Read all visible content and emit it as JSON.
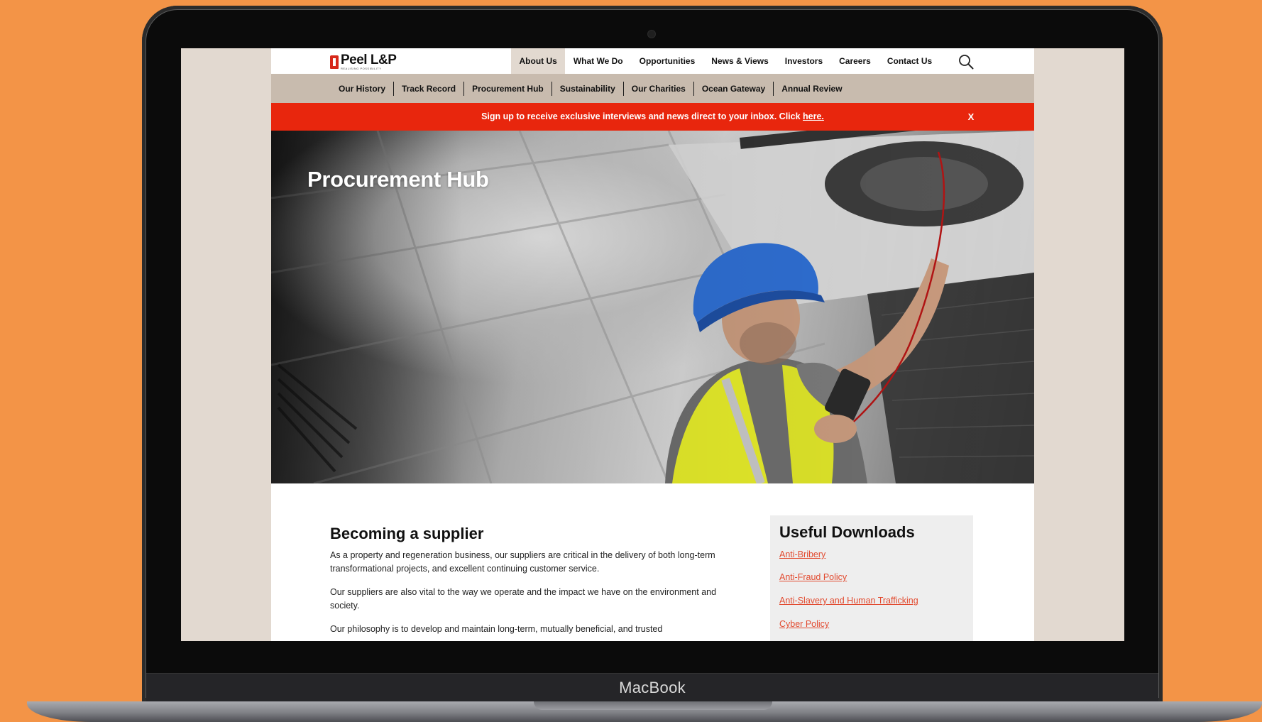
{
  "device": {
    "brand_label": "MacBook"
  },
  "header": {
    "logo_name": "Peel L&P",
    "logo_tagline": "REALISING POSSIBILITY",
    "main_nav": [
      {
        "label": "About Us",
        "active": true
      },
      {
        "label": "What We Do"
      },
      {
        "label": "Opportunities"
      },
      {
        "label": "News & Views"
      },
      {
        "label": "Investors"
      },
      {
        "label": "Careers"
      },
      {
        "label": "Contact Us"
      }
    ],
    "sub_nav": [
      {
        "label": "Our History"
      },
      {
        "label": "Track Record"
      },
      {
        "label": "Procurement Hub",
        "active": true
      },
      {
        "label": "Sustainability"
      },
      {
        "label": "Our Charities"
      },
      {
        "label": "Ocean Gateway"
      },
      {
        "label": "Annual Review"
      }
    ]
  },
  "alert": {
    "text": "Sign up to receive exclusive interviews and news direct to your inbox. Click ",
    "link_label": "here.",
    "close_label": "X"
  },
  "hero": {
    "title": "Procurement Hub"
  },
  "main": {
    "heading": "Becoming a supplier",
    "paragraphs": [
      "As a property and regeneration business, our suppliers are critical in the delivery of both long-term transformational projects, and excellent continuing customer service.",
      "Our suppliers are also vital to the way we operate and the impact we have on the environment and society.",
      "Our philosophy is to develop and maintain long-term, mutually beneficial, and trusted"
    ]
  },
  "downloads": {
    "title": "Useful Downloads",
    "links": [
      {
        "label": "Anti-Bribery"
      },
      {
        "label": "Anti-Fraud Policy"
      },
      {
        "label": "Anti-Slavery and Human Trafficking"
      },
      {
        "label": "Cyber Policy"
      }
    ]
  },
  "colors": {
    "background_orange": "#f39447",
    "alert_red": "#e8260d",
    "sub_nav_beige": "#c8bbae",
    "link_red": "#e24a2f",
    "logo_red": "#d7281a"
  }
}
